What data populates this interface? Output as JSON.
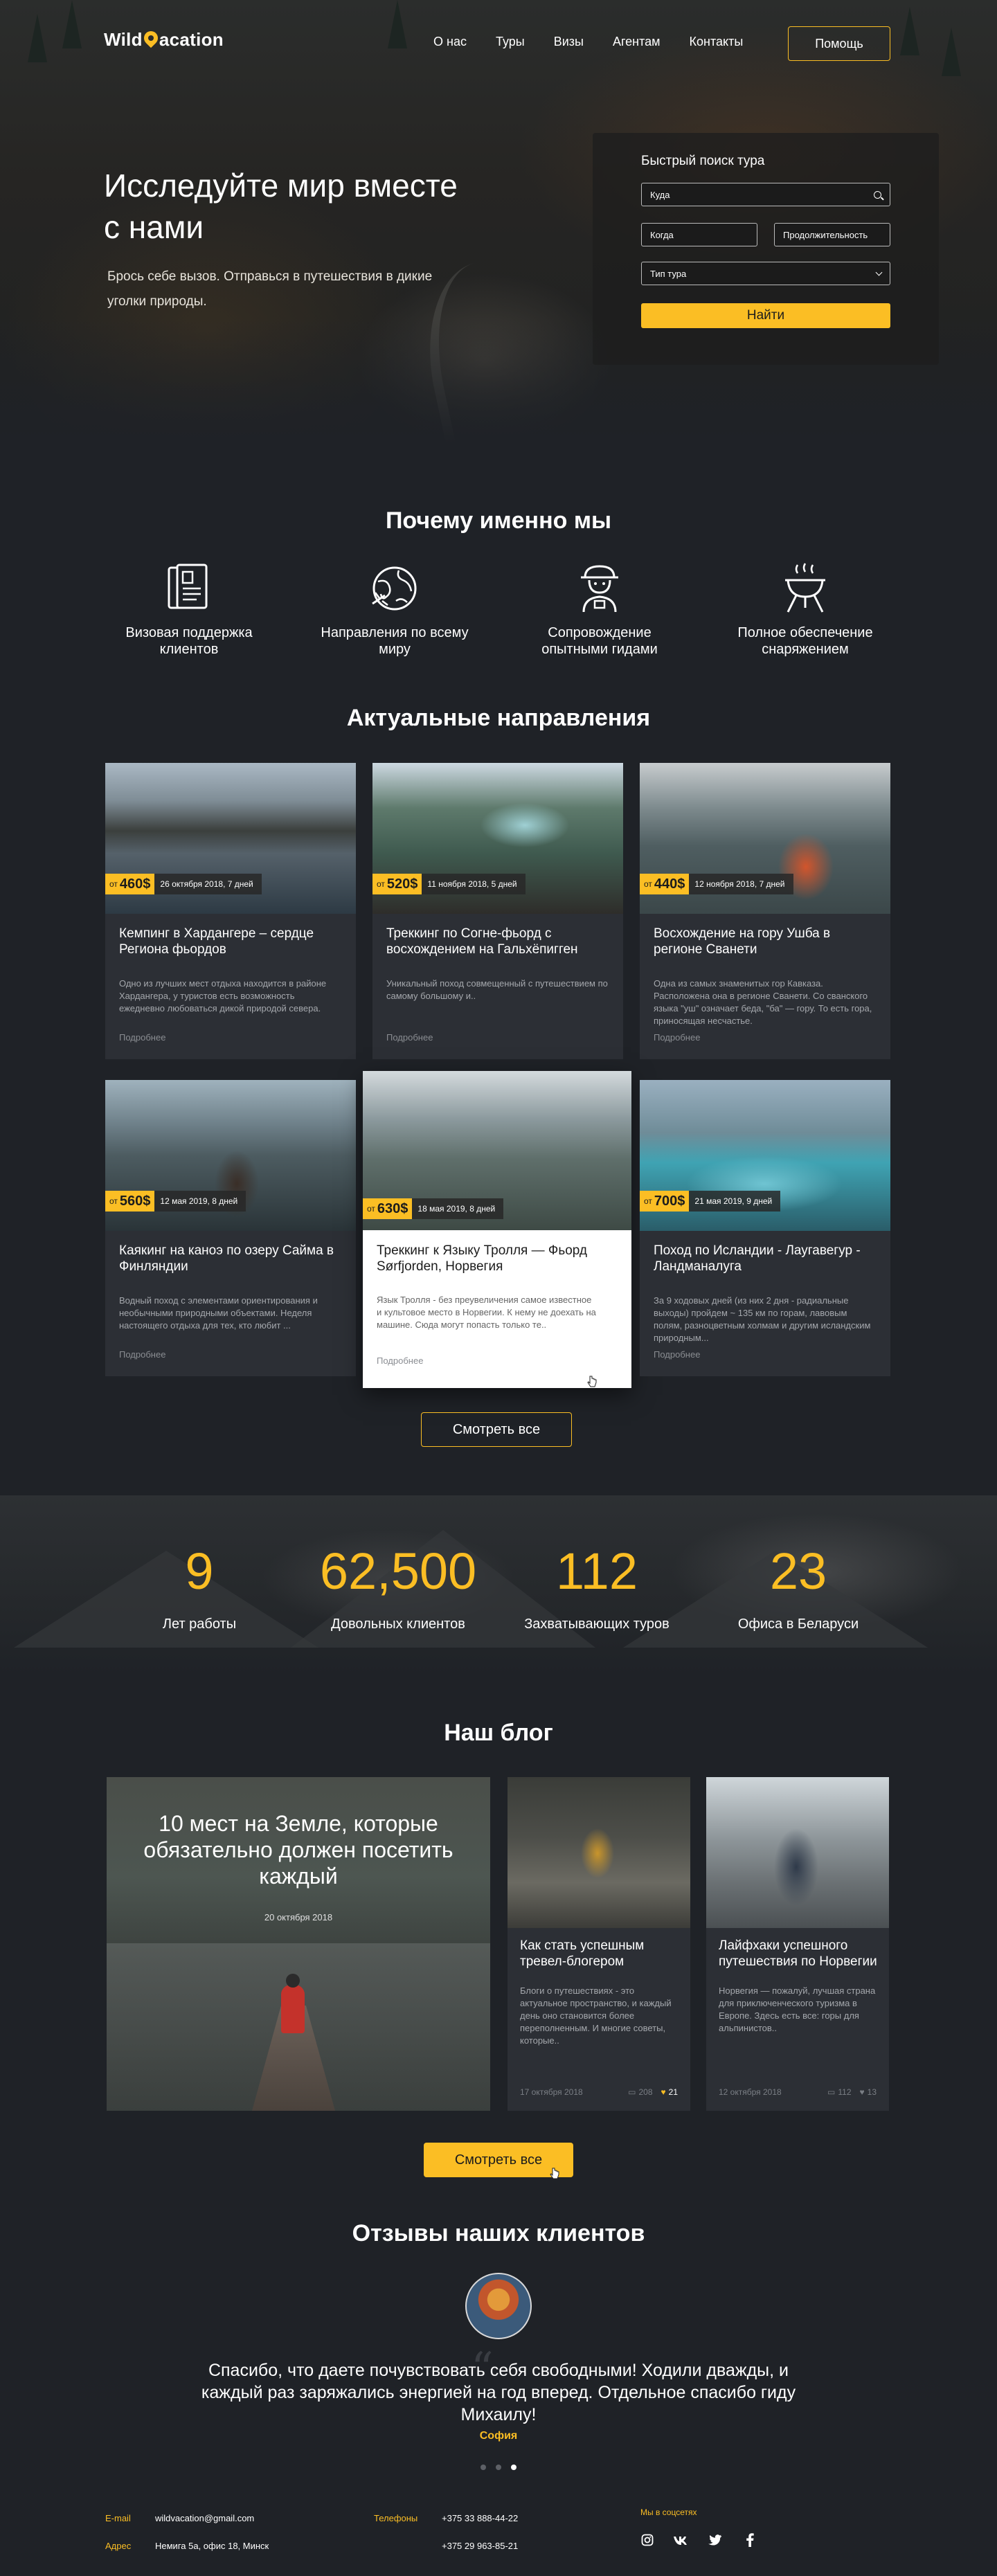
{
  "header": {
    "logo_left": "Wild",
    "logo_right": "acation",
    "nav": [
      "О нас",
      "Туры",
      "Визы",
      "Агентам",
      "Контакты"
    ],
    "help_button": "Помощь"
  },
  "hero": {
    "title": "Исследуйте мир вместе с нами",
    "subtitle": "Брось себе вызов. Отправься в путешествия в дикие уголки природы."
  },
  "quick_search": {
    "title": "Быстрый поиск тура",
    "where_placeholder": "Куда",
    "when_placeholder": "Когда",
    "duration_placeholder": "Продолжительность",
    "type_placeholder": "Тип тура",
    "find_button": "Найти"
  },
  "why": {
    "title": "Почему именно мы",
    "items": [
      {
        "label": "Визовая поддержка клиентов",
        "icon": "passport-icon"
      },
      {
        "label": "Направления по всему миру",
        "icon": "globe-icon"
      },
      {
        "label": "Сопровождение опытными гидами",
        "icon": "guide-icon"
      },
      {
        "label": "Полное обеспечение снаряжением",
        "icon": "grill-icon"
      }
    ]
  },
  "destinations": {
    "title": "Актуальные направления",
    "price_prefix": "от",
    "more_label": "Подробнее",
    "cards": [
      {
        "price": "460$",
        "meta": "26 октября 2018, 7 дней",
        "title": "Кемпинг в Хардангере – сердце Региона фьордов",
        "desc": "Одно из лучших мест отдыха находится в районе Хардангера, у туристов есть возможность ежедневно любоваться дикой природой севера."
      },
      {
        "price": "520$",
        "meta": "11 ноября 2018, 5 дней",
        "title": "Треккинг по Согне-фьорд с восхождением на Гальхёпигген",
        "desc": "Уникальный поход совмещенный с путешествием по самому большому и.."
      },
      {
        "price": "440$",
        "meta": "12 ноября 2018, 7 дней",
        "title": "Восхождение на гору Ушба в регионе Сванети",
        "desc": "Одна из самых знаменитых гор Кавказа. Расположена она в регионе Сванети. Со сванского языка \"уш\" означает беда, \"ба\" — гору. То есть гора, приносящая несчастье."
      },
      {
        "price": "560$",
        "meta": "12 мая 2019, 8 дней",
        "title": "Каякинг на каноэ по озеру Сайма в Финляндии",
        "desc": "Водный поход с элементами ориентирования и необычными природными объектами. Неделя настоящего отдыха для тех, кто любит ..."
      },
      {
        "price": "630$",
        "meta": "18 мая 2019, 8 дней",
        "title": "Треккинг к Языку Тролля — Фьорд Sørfjorden, Норвегия",
        "desc": "Язык Тролля - без преувеличения самое известное и культовое место в Норвегии. К нему не доехать на машине. Сюда могут попасть только те.."
      },
      {
        "price": "700$",
        "meta": "21 мая 2019, 9 дней",
        "title": "Поход по Исландии - Лаугавегур - Ландманалуга",
        "desc": "За 9 ходовых дней (из них 2 дня - радиальные выходы) пройдем ~ 135 км по горам, лавовым полям, разноцветным холмам и другим исландским природным..."
      }
    ],
    "see_all": "Смотреть все"
  },
  "stats": [
    {
      "num": "9",
      "label": "Лет работы"
    },
    {
      "num": "62,500",
      "label": "Довольных клиентов"
    },
    {
      "num": "112",
      "label": "Захватывающих туров"
    },
    {
      "num": "23",
      "label": "Офиса в Беларуси"
    }
  ],
  "blog": {
    "title": "Наш блог",
    "featured": {
      "title": "10 мест на Земле, которые обязательно должен посетить каждый",
      "date": "20 октября 2018"
    },
    "posts": [
      {
        "title": "Как стать успешным тревел-блогером",
        "desc": "Блоги о путешествиях - это актуальное пространство, и каждый день оно становится более переполненным. И многие советы, которые..",
        "date": "17 октября 2018",
        "comments": "208",
        "likes": "21"
      },
      {
        "title": "Лайфхаки успешного путешествия по Норвегии",
        "desc": "Норвегия — пожалуй, лучшая страна для приключенческого туризма в Европе. Здесь есть все: горы для альпинистов..",
        "date": "12 октября 2018",
        "comments": "112",
        "likes": "13"
      }
    ],
    "see_all": "Смотреть все"
  },
  "reviews": {
    "title": "Отзывы наших клиентов",
    "quote": "Спасибо, что даете почувствовать себя свободными! Ходили дважды, и каждый раз заряжались энергией на год вперед. Отдельное спасибо гиду Михаилу!",
    "author": "София"
  },
  "footer": {
    "email_label": "E-mail",
    "email": "wildvacation@gmail.com",
    "address_label": "Адрес",
    "address": "Немига 5а, офис 18,  Минск",
    "phones_label": "Телефоны",
    "phone1": "+375 33 888-44-22",
    "phone2": "+375 29 963-85-21",
    "social_label": "Мы в соцсетях",
    "social": [
      "instagram-icon",
      "vk-icon",
      "twitter-icon",
      "facebook-icon"
    ]
  },
  "colors": {
    "accent": "#fbbe24",
    "background": "#1f2227",
    "card": "#2c2f35"
  }
}
